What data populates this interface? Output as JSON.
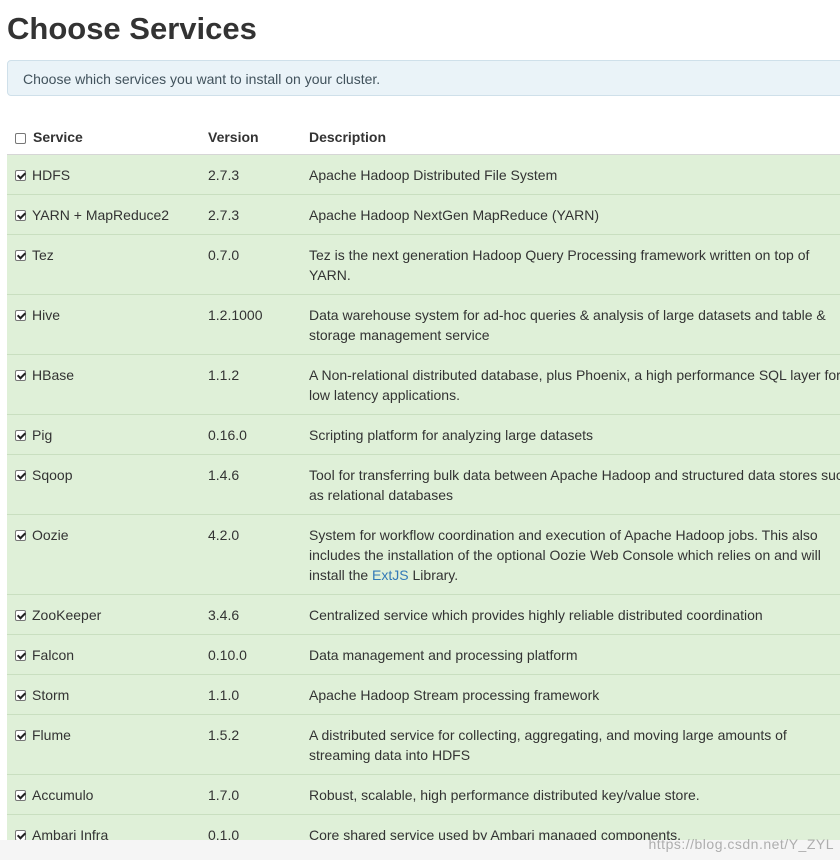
{
  "page": {
    "title": "Choose Services",
    "info": "Choose which services you want to install on your cluster."
  },
  "table": {
    "headers": {
      "service": "Service",
      "version": "Version",
      "description": "Description"
    },
    "select_all_checked": false,
    "rows": [
      {
        "name": "HDFS",
        "version": "2.7.3",
        "description": "Apache Hadoop Distributed File System",
        "checked": true
      },
      {
        "name": "YARN + MapReduce2",
        "version": "2.7.3",
        "description": "Apache Hadoop NextGen MapReduce (YARN)",
        "checked": true
      },
      {
        "name": "Tez",
        "version": "0.7.0",
        "description": "Tez is the next generation Hadoop Query Processing framework written on top of YARN.",
        "checked": true
      },
      {
        "name": "Hive",
        "version": "1.2.1000",
        "description": "Data warehouse system for ad-hoc queries & analysis of large datasets and table & storage management service",
        "checked": true
      },
      {
        "name": "HBase",
        "version": "1.1.2",
        "description": "A Non-relational distributed database, plus Phoenix, a high performance SQL layer for low latency applications.",
        "checked": true
      },
      {
        "name": "Pig",
        "version": "0.16.0",
        "description": "Scripting platform for analyzing large datasets",
        "checked": true
      },
      {
        "name": "Sqoop",
        "version": "1.4.6",
        "description": "Tool for transferring bulk data between Apache Hadoop and structured data stores such as relational databases",
        "checked": true
      },
      {
        "name": "Oozie",
        "version": "4.2.0",
        "description_pre": "System for workflow coordination and execution of Apache Hadoop jobs. This also includes the installation of the optional Oozie Web Console which relies on and will install the ",
        "description_link": "ExtJS",
        "description_post": " Library.",
        "checked": true
      },
      {
        "name": "ZooKeeper",
        "version": "3.4.6",
        "description": "Centralized service which provides highly reliable distributed coordination",
        "checked": true
      },
      {
        "name": "Falcon",
        "version": "0.10.0",
        "description": "Data management and processing platform",
        "checked": true
      },
      {
        "name": "Storm",
        "version": "1.1.0",
        "description": "Apache Hadoop Stream processing framework",
        "checked": true
      },
      {
        "name": "Flume",
        "version": "1.5.2",
        "description": "A distributed service for collecting, aggregating, and moving large amounts of streaming data into HDFS",
        "checked": true
      },
      {
        "name": "Accumulo",
        "version": "1.7.0",
        "description": "Robust, scalable, high performance distributed key/value store.",
        "checked": true
      },
      {
        "name": "Ambari Infra",
        "version": "0.1.0",
        "description": "Core shared service used by Ambari managed components.",
        "checked": true
      }
    ]
  },
  "watermark": "https://blog.csdn.net/Y_ZYL",
  "colors": {
    "row_background": "#dff0d8",
    "info_background": "#eaf3f8",
    "link": "#337ab7"
  }
}
